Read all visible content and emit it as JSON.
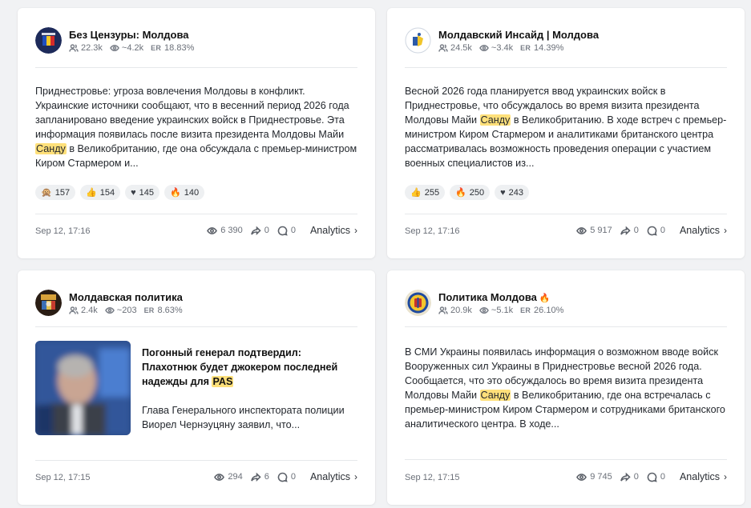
{
  "posts": [
    {
      "channel": "Без Цензуры: Молдова",
      "subscribers": "22.3k",
      "views_avg": "~4.2k",
      "er_label": "ER",
      "er": "18.83%",
      "text_pre": "Приднестровье: угроза вовлечения Молдовы в конфликт. Украинские источники сообщают, что в весенний период 2026 года запланировано введение украинских войск в Приднестровье. Эта информация появилась после визита президента Молдовы Майи ",
      "highlight": "Санду",
      "text_post": " в Великобританию, где она обсуждала с премьер-министром Киром Стармером и...",
      "reactions": [
        {
          "emoji": "🙊",
          "count": "157"
        },
        {
          "emoji": "👍",
          "count": "154"
        },
        {
          "emoji": "♥",
          "count": "145"
        },
        {
          "emoji": "🔥",
          "count": "140"
        }
      ],
      "date": "Sep 12, 17:16",
      "views": "6 390",
      "shares": "0",
      "comments": "0",
      "analytics": "Analytics"
    },
    {
      "channel": "Молдавский Инсайд | Молдова",
      "subscribers": "24.5k",
      "views_avg": "~3.4k",
      "er_label": "ER",
      "er": "14.39%",
      "text_pre": "Весной 2026 года планируется ввод украинских войск в Приднестровье, что обсуждалось во время визита президента Молдовы Майи ",
      "highlight": "Санду",
      "text_post": " в Великобританию. В ходе встреч с премьер-министром Киром Стармером и аналитиками британского центра рассматривалась возможность проведения операции с участием военных специалистов из...",
      "reactions": [
        {
          "emoji": "👍",
          "count": "255"
        },
        {
          "emoji": "🔥",
          "count": "250"
        },
        {
          "emoji": "♥",
          "count": "243"
        }
      ],
      "date": "Sep 12, 17:16",
      "views": "5 917",
      "shares": "0",
      "comments": "0",
      "analytics": "Analytics"
    },
    {
      "channel": "Молдавская политика",
      "subscribers": "2.4k",
      "views_avg": "~203",
      "er_label": "ER",
      "er": "8.63%",
      "title_pre": "Погонный генерал подтвердил: Плахотнюк будет джокером последней надежды для ",
      "highlight": "PAS",
      "description": "Глава Генерального инспектората полиции Виорел Чернэуцяну заявил, что...",
      "date": "Sep 12, 17:15",
      "views": "294",
      "shares": "6",
      "comments": "0",
      "analytics": "Analytics"
    },
    {
      "channel": "Политика Молдова",
      "channel_badge": "🔥",
      "subscribers": "20.9k",
      "views_avg": "~5.1k",
      "er_label": "ER",
      "er": "26.10%",
      "text_pre": "В СМИ Украины появилась информация о возможном вводе войск Вооруженных сил Украины в Приднестровье весной 2026 года. Сообщается, что это обсуждалось во время визита президента Молдовы Майи ",
      "highlight": "Санду",
      "text_post": " в Великобританию, где она встречалась с премьер-министром Киром Стармером и сотрудниками британского аналитического центра. В ходе...",
      "date": "Sep 12, 17:15",
      "views": "9 745",
      "shares": "0",
      "comments": "0",
      "analytics": "Analytics"
    }
  ],
  "colors": {
    "background": "#f1f2f4",
    "card": "#ffffff",
    "highlight": "#ffe07a",
    "reaction_bg": "#eef0f2",
    "muted_text": "#6b7079"
  },
  "icons": {
    "subscribers": "users-icon",
    "views": "eye-icon",
    "share": "share-arrow-icon",
    "comment": "comment-bubble-icon",
    "chevron": "chevron-right-icon"
  }
}
